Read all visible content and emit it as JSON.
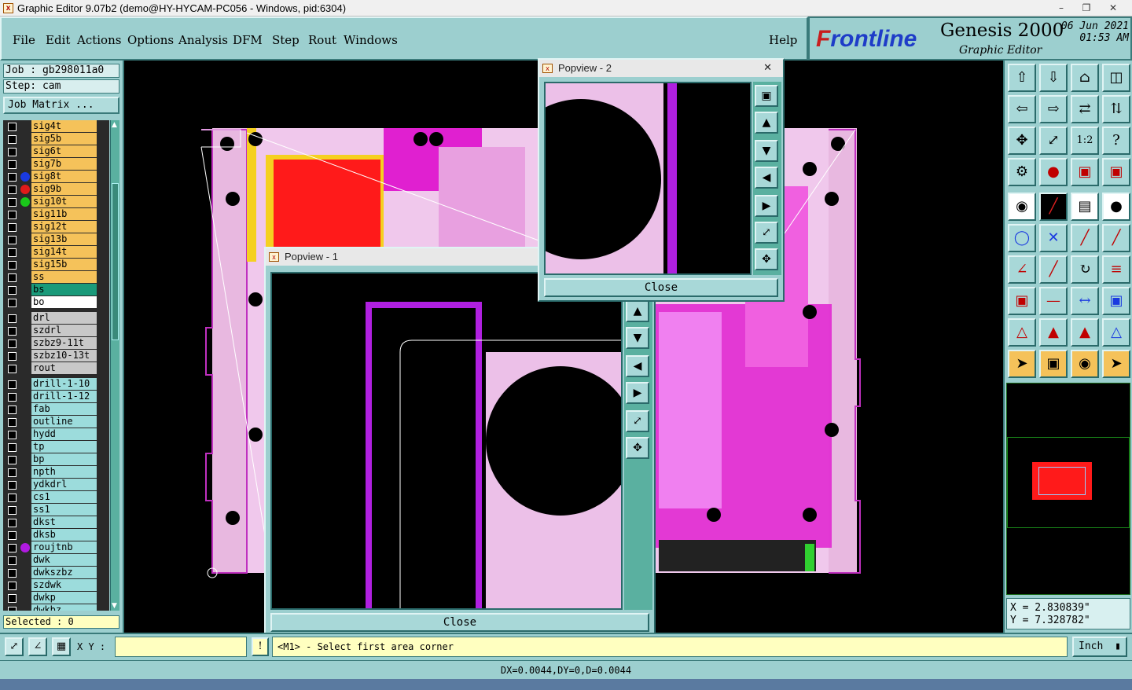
{
  "window": {
    "title": "Graphic Editor 9.07b2 (demo@HY-HYCAM-PC056 - Windows, pid:6304)",
    "app_icon": "x-icon"
  },
  "menu": [
    "File",
    "Edit",
    "Actions",
    "Options",
    "Analysis",
    "DFM",
    "Step",
    "Rout",
    "Windows"
  ],
  "help": "Help",
  "brand": {
    "logo_f": "F",
    "logo_rest": "rontline",
    "product": "Genesis 2000",
    "subtitle": "Graphic Editor",
    "date": "06 Jun 2021",
    "time": "01:53 AM"
  },
  "job": {
    "job_label": "Job : gb298011a0",
    "step_label": "Step: cam",
    "matrix_button": "Job Matrix ..."
  },
  "layers": [
    {
      "name": "sig4t",
      "kind": "sig",
      "dot": ""
    },
    {
      "name": "sig5b",
      "kind": "sig",
      "dot": ""
    },
    {
      "name": "sig6t",
      "kind": "sig",
      "dot": ""
    },
    {
      "name": "sig7b",
      "kind": "sig",
      "dot": ""
    },
    {
      "name": "sig8t",
      "kind": "sig",
      "dot": "#1a3ae0"
    },
    {
      "name": "sig9b",
      "kind": "sig",
      "dot": "#e01a1a"
    },
    {
      "name": "sig10t",
      "kind": "sig",
      "dot": "#1ac81a"
    },
    {
      "name": "sig11b",
      "kind": "sig",
      "dot": ""
    },
    {
      "name": "sig12t",
      "kind": "sig",
      "dot": ""
    },
    {
      "name": "sig13b",
      "kind": "sig",
      "dot": ""
    },
    {
      "name": "sig14t",
      "kind": "sig",
      "dot": ""
    },
    {
      "name": "sig15b",
      "kind": "sig",
      "dot": ""
    },
    {
      "name": "ss",
      "kind": "sig",
      "dot": ""
    },
    {
      "name": "bs",
      "kind": "sel",
      "dot": ""
    },
    {
      "name": "bo",
      "kind": "act",
      "dot": ""
    },
    {
      "name": "",
      "kind": "gap",
      "dot": ""
    },
    {
      "name": "drl",
      "kind": "drl",
      "dot": ""
    },
    {
      "name": "szdrl",
      "kind": "drl",
      "dot": ""
    },
    {
      "name": "szbz9-11t",
      "kind": "drl",
      "dot": ""
    },
    {
      "name": "szbz10-13t",
      "kind": "drl",
      "dot": ""
    },
    {
      "name": "rout",
      "kind": "drl",
      "dot": ""
    },
    {
      "name": "",
      "kind": "gap",
      "dot": ""
    },
    {
      "name": "drill-1-10",
      "kind": "misc",
      "dot": ""
    },
    {
      "name": "drill-1-12",
      "kind": "misc",
      "dot": ""
    },
    {
      "name": "fab",
      "kind": "misc",
      "dot": ""
    },
    {
      "name": "outline",
      "kind": "misc",
      "dot": ""
    },
    {
      "name": "hydd",
      "kind": "misc",
      "dot": ""
    },
    {
      "name": "tp",
      "kind": "misc",
      "dot": ""
    },
    {
      "name": "bp",
      "kind": "misc",
      "dot": ""
    },
    {
      "name": "npth",
      "kind": "misc",
      "dot": ""
    },
    {
      "name": "ydkdrl",
      "kind": "misc",
      "dot": ""
    },
    {
      "name": "cs1",
      "kind": "misc",
      "dot": ""
    },
    {
      "name": "ss1",
      "kind": "misc",
      "dot": ""
    },
    {
      "name": "dkst",
      "kind": "misc",
      "dot": ""
    },
    {
      "name": "dksb",
      "kind": "misc",
      "dot": ""
    },
    {
      "name": "roujtnb",
      "kind": "misc",
      "dot": "#b01ae0"
    },
    {
      "name": "dwk",
      "kind": "misc",
      "dot": ""
    },
    {
      "name": "dwkszbz",
      "kind": "misc",
      "dot": ""
    },
    {
      "name": "szdwk",
      "kind": "misc",
      "dot": ""
    },
    {
      "name": "dwkp",
      "kind": "misc",
      "dot": ""
    },
    {
      "name": "dwkbz",
      "kind": "misc",
      "dot": ""
    }
  ],
  "selected": "Selected : 0",
  "popview1": {
    "title": "Popview - 1",
    "close": "Close"
  },
  "popview2": {
    "title": "Popview - 2",
    "close": "Close",
    "x": "✕"
  },
  "coords": {
    "x": "X = 2.830839\"",
    "y": "Y = 7.328782\""
  },
  "bottom": {
    "xy_label": "X Y :",
    "xy_value": "",
    "warn": "!",
    "message": "<M1> - Select first area corner",
    "unit": "Inch"
  },
  "status": "DX=0.0044,DY=0,D=0.0044",
  "colors": {
    "panel": "#9ccfcf",
    "signal": "#f5c25a",
    "board": "#e8b8e0",
    "magenta": "#e020d0",
    "red": "#ff1a1a"
  }
}
